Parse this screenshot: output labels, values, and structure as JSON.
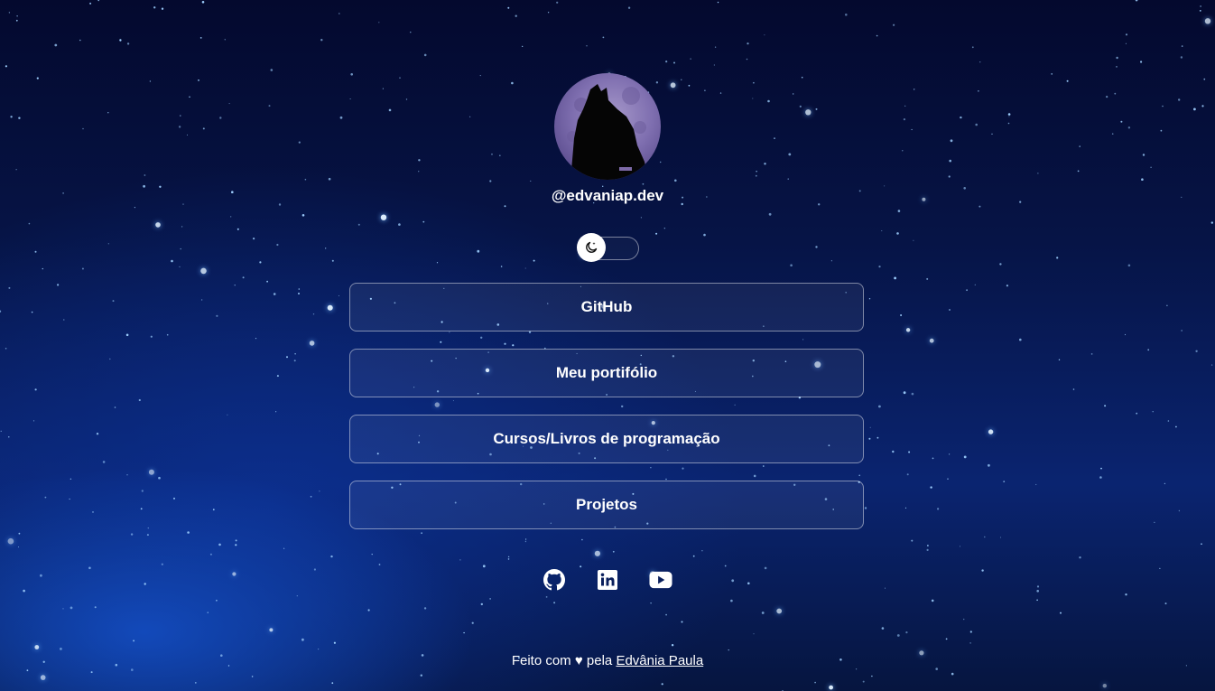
{
  "profile": {
    "handle": "@edvaniap.dev"
  },
  "theme_toggle": {
    "icon": "moon-stars-icon"
  },
  "links": [
    {
      "label": "GitHub"
    },
    {
      "label": "Meu portifólio"
    },
    {
      "label": "Cursos/Livros de programação"
    },
    {
      "label": "Projetos"
    }
  ],
  "socials": [
    {
      "icon": "github-icon"
    },
    {
      "icon": "linkedin-icon"
    },
    {
      "icon": "youtube-icon"
    }
  ],
  "footer": {
    "prefix": "Feito com ♥ pela",
    "author": "Edvânia Paula"
  },
  "colors": {
    "background_top": "#04092e",
    "background_glow": "#1450c8",
    "text": "#ffffff",
    "button_border": "rgba(255,255,255,0.45)"
  }
}
